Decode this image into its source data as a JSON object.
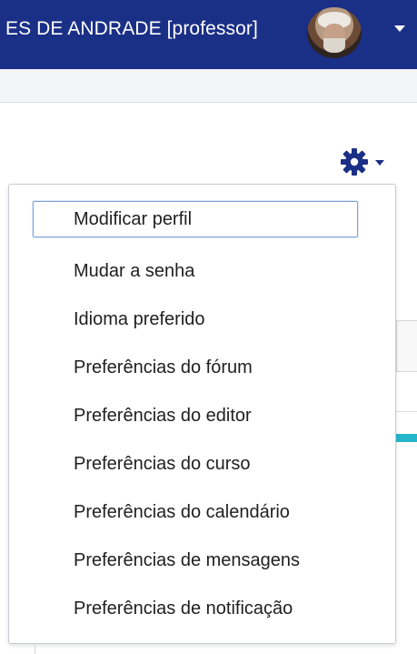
{
  "header": {
    "user_name": "ES DE ANDRADE [professor]",
    "avatar_icon": "user-avatar"
  },
  "settings_menu": {
    "toggle_icon": "gear-icon",
    "items": [
      {
        "label": "Modificar perfil",
        "focused": true
      },
      {
        "label": "Mudar a senha"
      },
      {
        "label": "Idioma preferido"
      },
      {
        "label": "Preferências do fórum"
      },
      {
        "label": "Preferências do editor"
      },
      {
        "label": "Preferências do curso"
      },
      {
        "label": "Preferências do calendário"
      },
      {
        "label": "Preferências de mensagens"
      },
      {
        "label": "Preferências de notificação"
      }
    ]
  },
  "colors": {
    "navbar": "#1a2f86",
    "gear": "#1a2f86",
    "accent_cyan": "#26b6c9",
    "focus_border": "#7ea4dc"
  }
}
